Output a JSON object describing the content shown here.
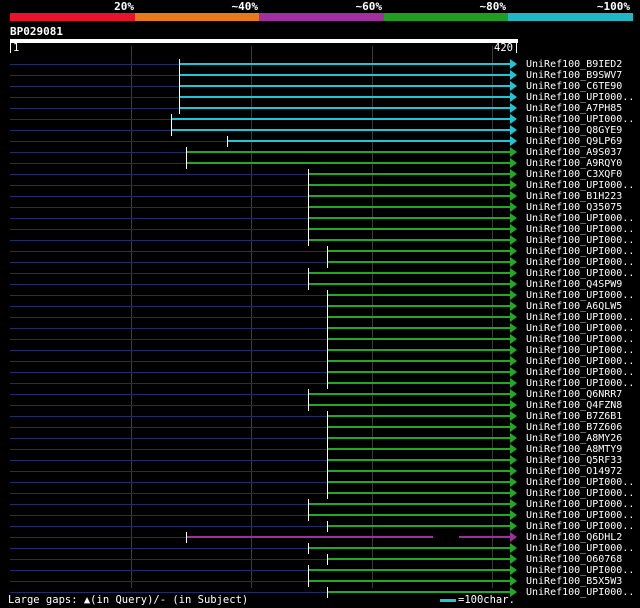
{
  "header": {
    "percent_labels": [
      "20%",
      "~40%",
      "~60%",
      "~80%",
      "~100%"
    ],
    "colors": [
      "#e8132b",
      "#e87a1a",
      "#a12fa0",
      "#1f9e1f",
      "#1fb8c4"
    ]
  },
  "query": {
    "id": "BP029081",
    "start": "1",
    "end": "420"
  },
  "legend": {
    "gaps_text": "Large gaps: ▲(in Query)/- (in Subject)",
    "scale_text": "=100char."
  },
  "hits": [
    {
      "name": "UniRef100_B9IED2",
      "start": 140,
      "tier": "cyan"
    },
    {
      "name": "UniRef100_B9SWV7",
      "start": 140,
      "tier": "cyan"
    },
    {
      "name": "UniRef100_C6TE90",
      "start": 140,
      "tier": "cyan"
    },
    {
      "name": "UniRef100_UPI000..",
      "start": 140,
      "tier": "cyan"
    },
    {
      "name": "UniRef100_A7PH85",
      "start": 140,
      "tier": "cyan"
    },
    {
      "name": "UniRef100_UPI000..",
      "start": 134,
      "tier": "cyan"
    },
    {
      "name": "UniRef100_Q8GYE9",
      "start": 134,
      "tier": "cyan"
    },
    {
      "name": "UniRef100_Q9LP69",
      "start": 180,
      "tier": "cyan"
    },
    {
      "name": "UniRef100_A9S037",
      "start": 146,
      "tier": "green"
    },
    {
      "name": "UniRef100_A9RQY0",
      "start": 146,
      "tier": "green"
    },
    {
      "name": "UniRef100_C3XQF0",
      "start": 247,
      "tier": "green"
    },
    {
      "name": "UniRef100_UPI000..",
      "start": 247,
      "tier": "green"
    },
    {
      "name": "UniRef100_B1H223",
      "start": 247,
      "tier": "green"
    },
    {
      "name": "UniRef100_Q35075",
      "start": 247,
      "tier": "green"
    },
    {
      "name": "UniRef100_UPI000..",
      "start": 247,
      "tier": "green"
    },
    {
      "name": "UniRef100_UPI000..",
      "start": 247,
      "tier": "green"
    },
    {
      "name": "UniRef100_UPI000..",
      "start": 247,
      "tier": "green"
    },
    {
      "name": "UniRef100_UPI000..",
      "start": 263,
      "tier": "green"
    },
    {
      "name": "UniRef100_UPI000..",
      "start": 263,
      "tier": "green"
    },
    {
      "name": "UniRef100_UPI000..",
      "start": 247,
      "tier": "green"
    },
    {
      "name": "UniRef100_Q4SPW9",
      "start": 247,
      "tier": "green"
    },
    {
      "name": "UniRef100_UPI000..",
      "start": 263,
      "tier": "green"
    },
    {
      "name": "UniRef100_A6QLW5",
      "start": 263,
      "tier": "green"
    },
    {
      "name": "UniRef100_UPI000..",
      "start": 263,
      "tier": "green"
    },
    {
      "name": "UniRef100_UPI000..",
      "start": 263,
      "tier": "green"
    },
    {
      "name": "UniRef100_UPI000..",
      "start": 263,
      "tier": "green"
    },
    {
      "name": "UniRef100_UPI000..",
      "start": 263,
      "tier": "green"
    },
    {
      "name": "UniRef100_UPI000..",
      "start": 263,
      "tier": "green"
    },
    {
      "name": "UniRef100_UPI000..",
      "start": 263,
      "tier": "green"
    },
    {
      "name": "UniRef100_UPI000..",
      "start": 263,
      "tier": "green"
    },
    {
      "name": "UniRef100_Q6NRR7",
      "start": 247,
      "tier": "green"
    },
    {
      "name": "UniRef100_Q4FZN8",
      "start": 247,
      "tier": "green"
    },
    {
      "name": "UniRef100_B7Z6B1",
      "start": 263,
      "tier": "green"
    },
    {
      "name": "UniRef100_B7Z606",
      "start": 263,
      "tier": "green"
    },
    {
      "name": "UniRef100_A8MY26",
      "start": 263,
      "tier": "green"
    },
    {
      "name": "UniRef100_A8MTY9",
      "start": 263,
      "tier": "green"
    },
    {
      "name": "UniRef100_Q5RF33",
      "start": 263,
      "tier": "green"
    },
    {
      "name": "UniRef100_O14972",
      "start": 263,
      "tier": "green"
    },
    {
      "name": "UniRef100_UPI000..",
      "start": 263,
      "tier": "green"
    },
    {
      "name": "UniRef100_UPI000..",
      "start": 263,
      "tier": "green"
    },
    {
      "name": "UniRef100_UPI000..",
      "start": 247,
      "tier": "green"
    },
    {
      "name": "UniRef100_UPI000..",
      "start": 247,
      "tier": "green"
    },
    {
      "name": "UniRef100_UPI000..",
      "start": 263,
      "tier": "green"
    },
    {
      "name": "UniRef100_Q6DHL2",
      "start": 146,
      "tier": "purple"
    },
    {
      "name": "UniRef100_UPI000..",
      "start": 247,
      "tier": "green"
    },
    {
      "name": "UniRef100_O60768",
      "start": 263,
      "tier": "green"
    },
    {
      "name": "UniRef100_UPI000..",
      "start": 247,
      "tier": "green"
    },
    {
      "name": "UniRef100_B5X5W3",
      "start": 247,
      "tier": "green"
    },
    {
      "name": "UniRef100_UPI000..",
      "start": 263,
      "tier": "green"
    }
  ],
  "tier_colors": {
    "cyan": "#1fc6d6",
    "green": "#22a822",
    "purple": "#a12fa0"
  }
}
